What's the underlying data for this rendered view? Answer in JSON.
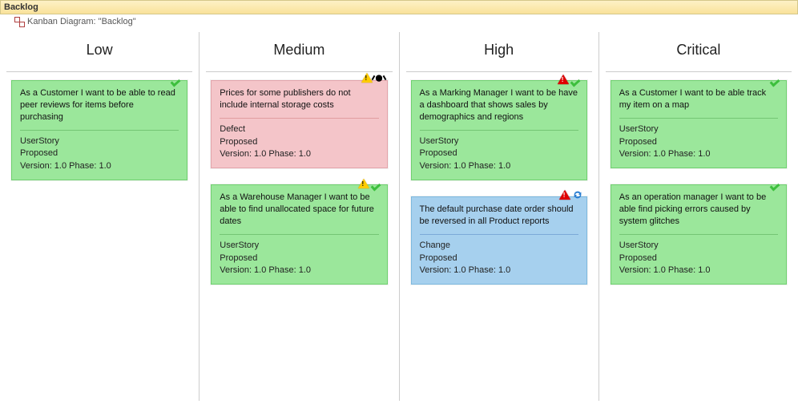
{
  "header": {
    "title": "Backlog",
    "diagram_label": "Kanban Diagram: \"Backlog\""
  },
  "columns": [
    {
      "name": "Low",
      "cards": [
        {
          "color": "green",
          "title": "As a Customer I want to be able to read peer reviews for items before purchasing",
          "type": "UserStory",
          "status": "Proposed",
          "version": "Version: 1.0 Phase: 1.0",
          "icons": [
            "check"
          ]
        }
      ]
    },
    {
      "name": "Medium",
      "cards": [
        {
          "color": "pink",
          "title": "Prices for some publishers do not include internal storage costs",
          "type": "Defect",
          "status": "Proposed",
          "version": "Version: 1.0 Phase: 1.0",
          "icons": [
            "warn",
            "bug"
          ]
        },
        {
          "color": "green",
          "title": "As a Warehouse Manager I want to be able to find unallocated space for future dates",
          "type": "UserStory",
          "status": "Proposed",
          "version": "Version: 1.0 Phase: 1.0",
          "icons": [
            "warn",
            "check"
          ]
        }
      ]
    },
    {
      "name": "High",
      "cards": [
        {
          "color": "green",
          "title": "As a Marking Manager I want to be have a dashboard that shows sales by demographics and regions",
          "type": "UserStory",
          "status": "Proposed",
          "version": "Version: 1.0 Phase: 1.0",
          "icons": [
            "crit",
            "check"
          ]
        },
        {
          "color": "blue",
          "title": "The default purchase date order should be reversed in all Product reports",
          "type": "Change",
          "status": "Proposed",
          "version": "Version: 1.0 Phase: 1.0",
          "icons": [
            "crit",
            "cycle"
          ]
        }
      ]
    },
    {
      "name": "Critical",
      "cards": [
        {
          "color": "green",
          "title": "As a Customer I want to be able track my item on a map",
          "type": "UserStory",
          "status": "Proposed",
          "version": "Version: 1.0 Phase: 1.0",
          "icons": [
            "check"
          ]
        },
        {
          "color": "green",
          "title": "As an operation manager I want to be able find picking errors caused by system glitches",
          "type": "UserStory",
          "status": "Proposed",
          "version": "Version: 1.0 Phase: 1.0",
          "icons": [
            "check"
          ]
        }
      ]
    }
  ]
}
